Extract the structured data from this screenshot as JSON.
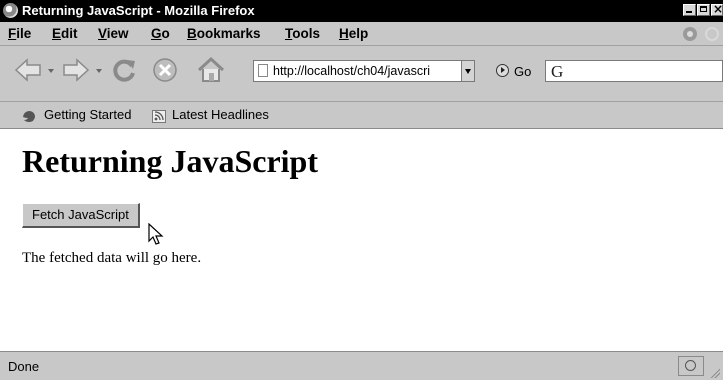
{
  "window": {
    "title": "Returning JavaScript - Mozilla Firefox"
  },
  "menu": {
    "items": [
      {
        "first": "F",
        "rest": "ile"
      },
      {
        "first": "E",
        "rest": "dit"
      },
      {
        "first": "V",
        "rest": "iew"
      },
      {
        "first": "G",
        "rest": "o"
      },
      {
        "first": "B",
        "rest": "ookmarks"
      },
      {
        "first": "T",
        "rest": "ools"
      },
      {
        "first": "H",
        "rest": "elp"
      }
    ]
  },
  "navigation": {
    "url": "http://localhost/ch04/javascri",
    "go_label": "Go",
    "search_engine_icon": "G"
  },
  "bookmarks": {
    "items": [
      "Getting Started",
      "Latest Headlines"
    ]
  },
  "page": {
    "heading": "Returning JavaScript",
    "fetch_button_label": "Fetch JavaScript",
    "output_text": "The fetched data will go here."
  },
  "status": {
    "text": "Done"
  },
  "icons": {
    "app": "firefox-icon",
    "back": "back-arrow-icon",
    "forward": "forward-arrow-icon",
    "reload": "reload-icon",
    "stop": "stop-icon",
    "home": "home-icon",
    "page": "page-icon",
    "go": "go-icon",
    "bookmark_getting_started": "firefox-bookmark-icon",
    "bookmark_latest_headlines": "rss-icon",
    "cursor": "mouse-pointer-icon"
  }
}
